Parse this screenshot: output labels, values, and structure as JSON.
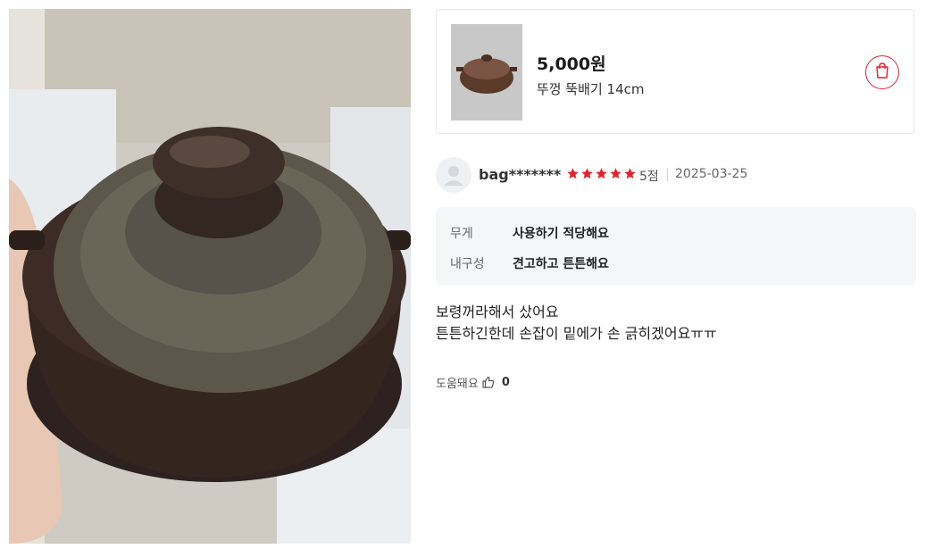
{
  "product": {
    "price": "5,000원",
    "name": "뚜껑 뚝배기 14cm",
    "accent_color": "#e0242f"
  },
  "review": {
    "user": "bag*******",
    "rating": 5,
    "rating_max": 5,
    "score_text": "5점",
    "date": "2025-03-25",
    "star_color": "#e0242f",
    "attributes": [
      {
        "label": "무게",
        "value": "사용하기 적당해요"
      },
      {
        "label": "내구성",
        "value": "견고하고 튼튼해요"
      }
    ],
    "text_lines": [
      "보령꺼라해서 샀어요",
      "튼튼하긴한데 손잡이 밑에가 손 긁히겠어요ㅠㅠ"
    ],
    "helpful_label": "도움돼요",
    "helpful_count": "0"
  }
}
